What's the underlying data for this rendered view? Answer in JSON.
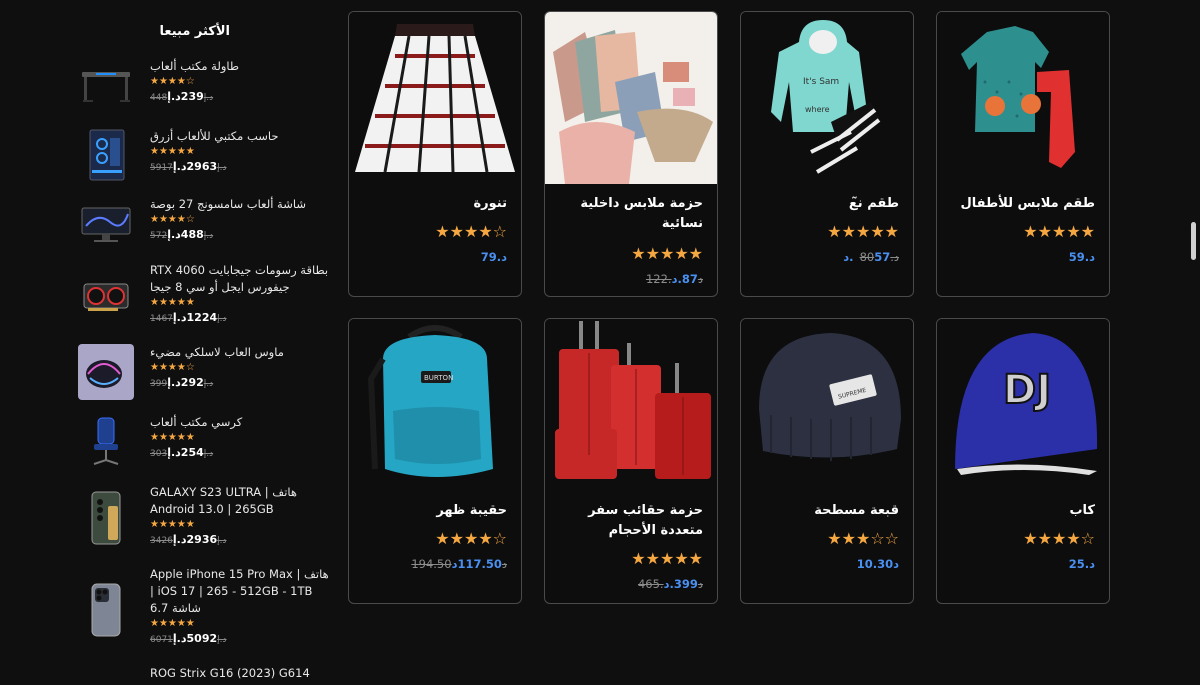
{
  "sidebar": {
    "title": "الأكثر مبيعا",
    "items": [
      {
        "name": "طاولة مكتب ألعاب",
        "stars": "★★★★☆",
        "old_price": "448د.إ",
        "new_price": "239د.إ",
        "icon": "desk-image"
      },
      {
        "name": "حاسب مكتبي للألعاب أزرق",
        "stars": "★★★★★",
        "old_price": "5917د.إ",
        "new_price": "2963د.إ",
        "icon": "pc-image"
      },
      {
        "name": "شاشة ألعاب سامسونج 27 بوصة",
        "stars": "★★★★☆",
        "old_price": "572د.إ",
        "new_price": "488د.إ",
        "icon": "monitor-image"
      },
      {
        "name": "بطاقة رسومات جيجابايت RTX 4060 جيفورس ايجل أو سي 8 جيجا",
        "stars": "★★★★★",
        "old_price": "1467د.إ",
        "new_price": "1224د.إ",
        "icon": "gpu-image"
      },
      {
        "name": "ماوس العاب لاسلكي مضيء",
        "stars": "★★★★☆",
        "old_price": "399د.إ",
        "new_price": "292د.إ",
        "icon": "mouse-image"
      },
      {
        "name": "كرسي مكتب ألعاب",
        "stars": "★★★★★",
        "old_price": "303د.إ",
        "new_price": "254د.إ",
        "icon": "chair-image"
      },
      {
        "name": "هاتف GALAXY S23 ULTRA | Android 13.0 | 265GB",
        "stars": "★★★★★",
        "old_price": "3426د.إ",
        "new_price": "2936د.إ",
        "icon": "phone-image"
      },
      {
        "name": "هاتف Apple iPhone 15 Pro Max | iOS 17 | 265 - 512GB - 1TB | شاشة 6.7",
        "stars": "★★★★★",
        "old_price": "6071د.إ",
        "new_price": "5092د.إ",
        "icon": "iphone-image"
      },
      {
        "name": "ROG Strix G16 (2023) G614",
        "stars": "",
        "old_price": "",
        "new_price": "",
        "icon": "laptop-image"
      }
    ]
  },
  "products": [
    {
      "title": "طقم ملابس للأطفال",
      "stars": "★★★★★",
      "old_price": "",
      "new_price": "59.د",
      "icon": "kids-outfit-image"
    },
    {
      "title": "طقم ن̃ع",
      "stars": "★★★★★",
      "old_price": "د.80",
      "new_price": "57.د",
      "icon": "baby-outfit-image"
    },
    {
      "title": "حزمة ملابس داخلية نسائية",
      "stars": "★★★★★",
      "old_price": "122.د",
      "new_price": "87.د",
      "icon": "underwear-image"
    },
    {
      "title": "تنورة",
      "stars": "★★★★☆",
      "old_price": "",
      "new_price": "79.د",
      "icon": "skirt-image"
    },
    {
      "title": "كاب",
      "stars": "★★★★☆",
      "old_price": "",
      "new_price": "25.د",
      "icon": "cap-image"
    },
    {
      "title": "قبعة مسطحة",
      "stars": "★★★☆☆",
      "old_price": "",
      "new_price": "10.30د",
      "icon": "beanie-image"
    },
    {
      "title": "حزمة حقائب سفر متعددة الأحجام",
      "stars": "★★★★★",
      "old_price": "465.د",
      "new_price": "399.د",
      "icon": "luggage-image"
    },
    {
      "title": "حقيبة ظهر",
      "stars": "★★★★☆",
      "old_price": "194.50د",
      "new_price": "117.50د",
      "icon": "backpack-image"
    }
  ]
}
